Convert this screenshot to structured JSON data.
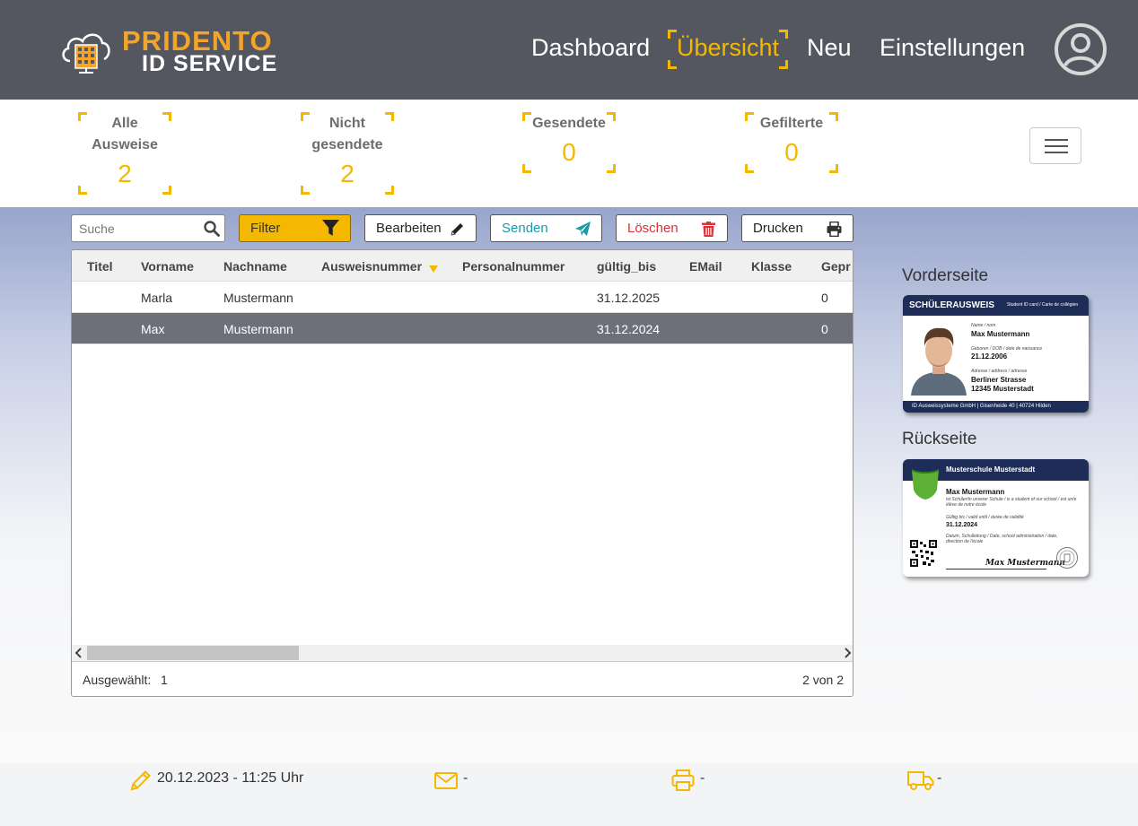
{
  "brand": {
    "line1": "PRIDENTO",
    "line2": "ID SERVICE"
  },
  "nav": {
    "items": [
      "Dashboard",
      "Übersicht",
      "Neu",
      "Einstellungen"
    ],
    "active": "Übersicht"
  },
  "stats": {
    "all": {
      "label1": "Alle",
      "label2": "Ausweise",
      "value": "2"
    },
    "unsent": {
      "label1": "Nicht",
      "label2": "gesendete",
      "value": "2"
    },
    "sent": {
      "label": "Gesendete",
      "value": "0"
    },
    "filtered": {
      "label": "Gefilterte",
      "value": "0"
    }
  },
  "toolbar": {
    "search_placeholder": "Suche",
    "filter": "Filter",
    "edit": "Bearbeiten",
    "send": "Senden",
    "delete": "Löschen",
    "print": "Drucken"
  },
  "table": {
    "columns": [
      "Titel",
      "Vorname",
      "Nachname",
      "Ausweisnummer",
      "Personalnummer",
      "gültig_bis",
      "EMail",
      "Klasse",
      "Gepr"
    ],
    "rows": [
      {
        "titel": "",
        "vorname": "Marla",
        "nachname": "Mustermann",
        "ausweisnummer": "",
        "personalnummer": "",
        "gueltig_bis": "31.12.2025",
        "email": "",
        "klasse": "",
        "gepr": "0"
      },
      {
        "titel": "",
        "vorname": "Max",
        "nachname": "Mustermann",
        "ausweisnummer": "",
        "personalnummer": "",
        "gueltig_bis": "31.12.2024",
        "email": "",
        "klasse": "",
        "gepr": "0"
      }
    ],
    "selected_label": "Ausgewählt:",
    "selected_count": "1",
    "pagination": "2 von 2"
  },
  "preview": {
    "front_title": "Vorderseite",
    "back_title": "Rückseite",
    "front": {
      "header": "SCHÜLERAUSWEIS",
      "header_sub": "Student ID card / Carte de collégien",
      "name_label": "Name / nom",
      "name": "Max Mustermann",
      "dob_label": "Geboren / DOB / date de naissance",
      "dob": "21.12.2006",
      "addr_label": "Adresse / address / adresse",
      "addr1": "Berliner Strasse",
      "addr2": "12345 Musterstadt",
      "footer": "ID Ausweissysteme GmbH | Gisenheide 40 | 40724 Hilden"
    },
    "back": {
      "school": "Musterschule Musterstadt",
      "name": "Max Mustermann",
      "desc": "ist Schüler/in unserer Schule / is a student of our school / est un/e élève de notre école",
      "valid_label": "Gültig bis / valid until / durée de validité",
      "valid": "31.12.2024",
      "sign_label": "Datum, Schulleitung / Date, school administration / date, direction de l'école",
      "signature": "Max Mustermann"
    }
  },
  "footer": {
    "edited": "20.12.2023 - 11:25 Uhr",
    "mail": "-",
    "print": "-",
    "ship": "-"
  },
  "colors": {
    "accent": "#f5b800",
    "header_bg": "#54575f",
    "selected_row": "#6d7078"
  }
}
